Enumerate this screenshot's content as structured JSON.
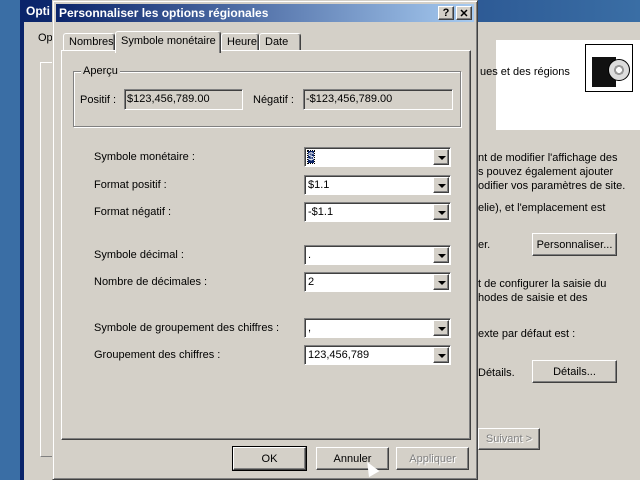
{
  "background_window": {
    "title_fragment": "Opti",
    "tab_fragment": "Op",
    "text_regions": "ues et des régions",
    "text_desc1": "nt de modifier l'affichage des",
    "text_desc2": "s pouvez également ajouter",
    "text_desc3": "odifier vos paramètres de site.",
    "text_desc4": "elie), et l'emplacement est",
    "text_desc5": "er.",
    "customize_button": "Personnaliser...",
    "text_input1": "t de configurer la saisie du",
    "text_input2": "hodes de saisie et des",
    "text_input3": "exte par défaut est :",
    "text_details": "Détails.",
    "details_button": "Détails...",
    "next_button": "Suivant >"
  },
  "dialog": {
    "title": "Personnaliser les options régionales",
    "help_button": "?",
    "close_button": "✕",
    "tabs": [
      "Nombres",
      "Symbole monétaire",
      "Heure",
      "Date"
    ],
    "active_tab": "Symbole monétaire",
    "preview": {
      "legend": "Aperçu",
      "positive_label": "Positif :",
      "positive_value": "$123,456,789.00",
      "negative_label": "Négatif :",
      "negative_value": "-$123,456,789.00"
    },
    "fields": {
      "currency_symbol": {
        "label": "Symbole monétaire :",
        "value": "$"
      },
      "positive_format": {
        "label": "Format positif :",
        "value": "$1.1"
      },
      "negative_format": {
        "label": "Format négatif :",
        "value": "-$1.1"
      },
      "decimal_symbol": {
        "label": "Symbole décimal :",
        "value": "."
      },
      "decimal_count": {
        "label": "Nombre de décimales :",
        "value": "2"
      },
      "grouping_symbol": {
        "label": "Symbole de groupement des chiffres :",
        "value": ","
      },
      "digit_grouping": {
        "label": "Groupement des chiffres :",
        "value": "123,456,789"
      }
    },
    "buttons": {
      "ok": "OK",
      "cancel": "Annuler",
      "apply": "Appliquer"
    }
  }
}
